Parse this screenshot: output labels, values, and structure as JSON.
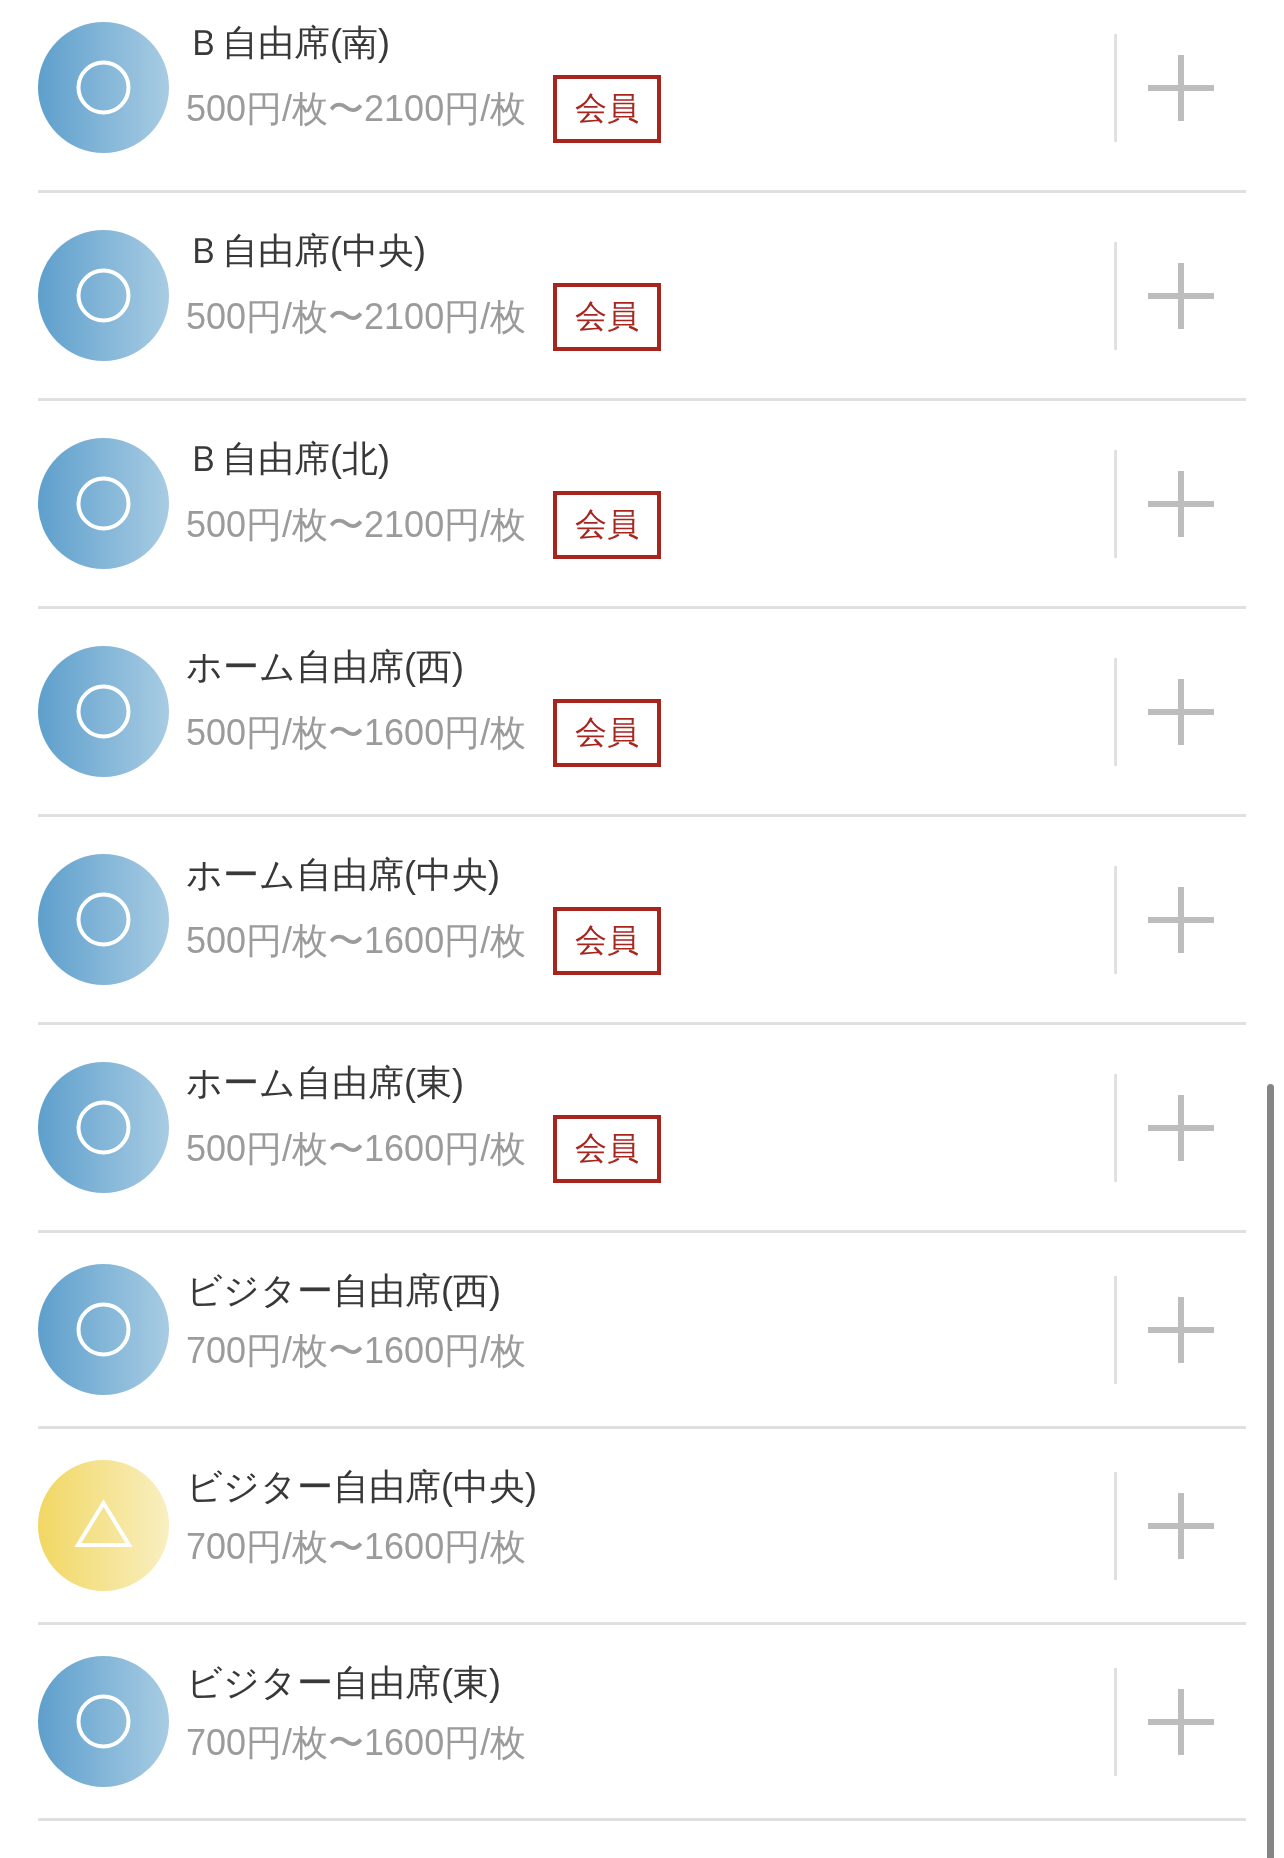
{
  "seats": [
    {
      "name": "Ｂ自由席(南)",
      "kind": "ring",
      "price": "500円/枚〜2100円/枚",
      "badge": "会員"
    },
    {
      "name": "Ｂ自由席(中央)",
      "kind": "ring",
      "price": "500円/枚〜2100円/枚",
      "badge": "会員"
    },
    {
      "name": "Ｂ自由席(北)",
      "kind": "ring",
      "price": "500円/枚〜2100円/枚",
      "badge": "会員"
    },
    {
      "name": "ホーム自由席(西)",
      "kind": "ring",
      "price": "500円/枚〜1600円/枚",
      "badge": "会員"
    },
    {
      "name": "ホーム自由席(中央)",
      "kind": "ring",
      "price": "500円/枚〜1600円/枚",
      "badge": "会員"
    },
    {
      "name": "ホーム自由席(東)",
      "kind": "ring",
      "price": "500円/枚〜1600円/枚",
      "badge": "会員"
    },
    {
      "name": "ビジター自由席(西)",
      "kind": "ring",
      "price": "700円/枚〜1600円/枚"
    },
    {
      "name": "ビジター自由席(中央)",
      "kind": "triangle",
      "price": "700円/枚〜1600円/枚"
    },
    {
      "name": "ビジター自由席(東)",
      "kind": "ring",
      "price": "700円/枚〜1600円/枚"
    }
  ]
}
